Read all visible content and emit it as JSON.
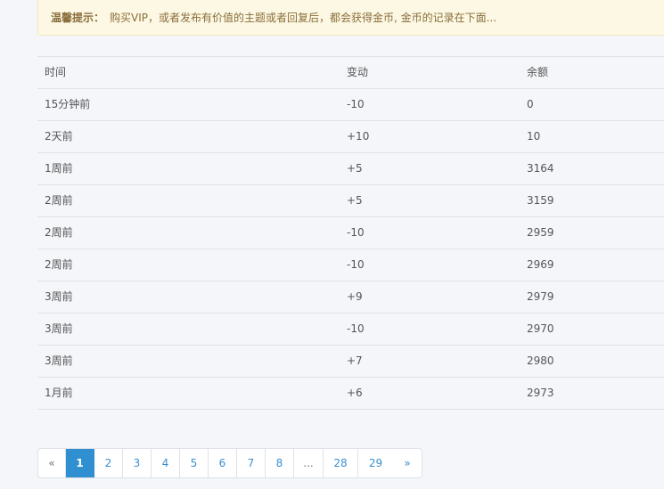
{
  "notice": {
    "label": "温馨提示：",
    "text": "购买VIP，或者发布有价值的主题或者回复后，都会获得金币, 金币的记录在下面..."
  },
  "table": {
    "headers": [
      "时间",
      "变动",
      "余额"
    ],
    "rows": [
      [
        "15分钟前",
        "-10",
        "0"
      ],
      [
        "2天前",
        "+10",
        "10"
      ],
      [
        "1周前",
        "+5",
        "3164"
      ],
      [
        "2周前",
        "+5",
        "3159"
      ],
      [
        "2周前",
        "-10",
        "2959"
      ],
      [
        "2周前",
        "-10",
        "2969"
      ],
      [
        "3周前",
        "+9",
        "2979"
      ],
      [
        "3周前",
        "-10",
        "2970"
      ],
      [
        "3周前",
        "+7",
        "2980"
      ],
      [
        "1月前",
        "+6",
        "2973"
      ]
    ]
  },
  "pagination": {
    "prev": "«",
    "pages": [
      "1",
      "2",
      "3",
      "4",
      "5",
      "6",
      "7",
      "8",
      "...",
      "28",
      "29"
    ],
    "next": "»",
    "current": "1"
  }
}
